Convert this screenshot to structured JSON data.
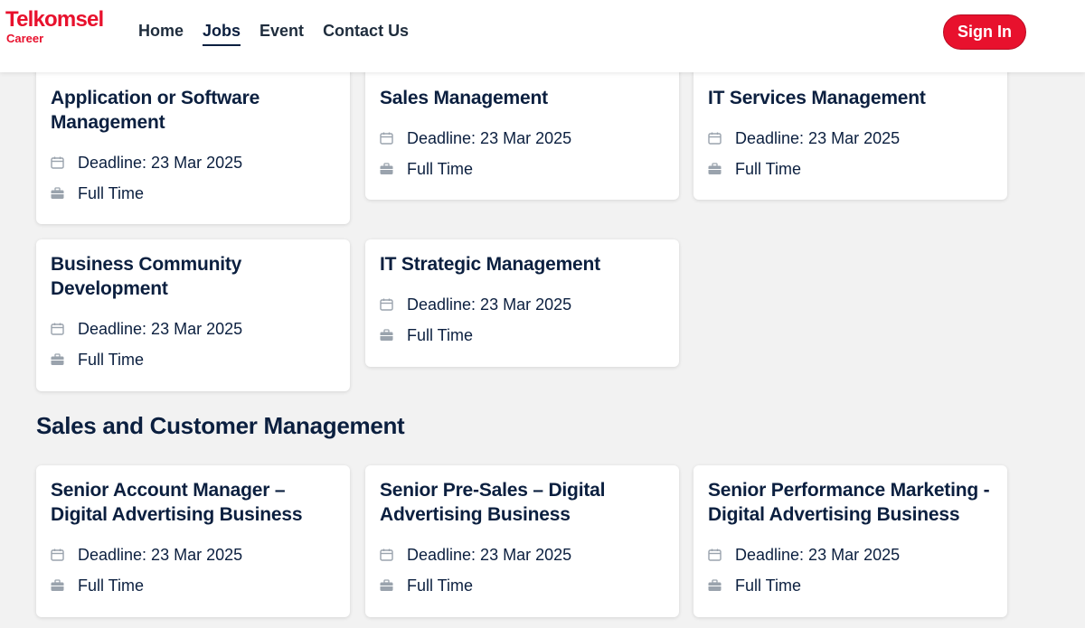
{
  "header": {
    "logo_title": "Telkomsel",
    "logo_subtitle": "Career",
    "nav": [
      "Home",
      "Jobs",
      "Event",
      "Contact Us"
    ],
    "active_nav": "Jobs",
    "signin_label": "Sign In"
  },
  "colors": {
    "brand_red": "#e8112d",
    "navy_text": "#0b1f3f",
    "page_background": "#f2f2f2",
    "icon_gray": "#9aa3ad"
  },
  "icons": {
    "deadline": "calendar-icon",
    "job_type": "briefcase-icon"
  },
  "group_top": {
    "jobs": [
      {
        "title": "Application or Software Management",
        "deadline": "Deadline: 23 Mar 2025",
        "type": "Full Time"
      },
      {
        "title": "Sales Management",
        "deadline": "Deadline: 23 Mar 2025",
        "type": "Full Time"
      },
      {
        "title": "IT Services Management",
        "deadline": "Deadline: 23 Mar 2025",
        "type": "Full Time"
      },
      {
        "title": "Business Community Development",
        "deadline": "Deadline: 23 Mar 2025",
        "type": "Full Time"
      },
      {
        "title": "IT Strategic Management",
        "deadline": "Deadline: 23 Mar 2025",
        "type": "Full Time"
      }
    ]
  },
  "section_sales": {
    "title": "Sales and Customer Management",
    "jobs": [
      {
        "title": "Senior Account Manager – Digital Advertising Business",
        "deadline": "Deadline: 23 Mar 2025",
        "type": "Full Time"
      },
      {
        "title": "Senior Pre-Sales – Digital Advertising Business",
        "deadline": "Deadline: 23 Mar 2025",
        "type": "Full Time"
      },
      {
        "title": "Senior Performance Marketing - Digital Advertising Business",
        "deadline": "Deadline: 23 Mar 2025",
        "type": "Full Time"
      }
    ]
  }
}
